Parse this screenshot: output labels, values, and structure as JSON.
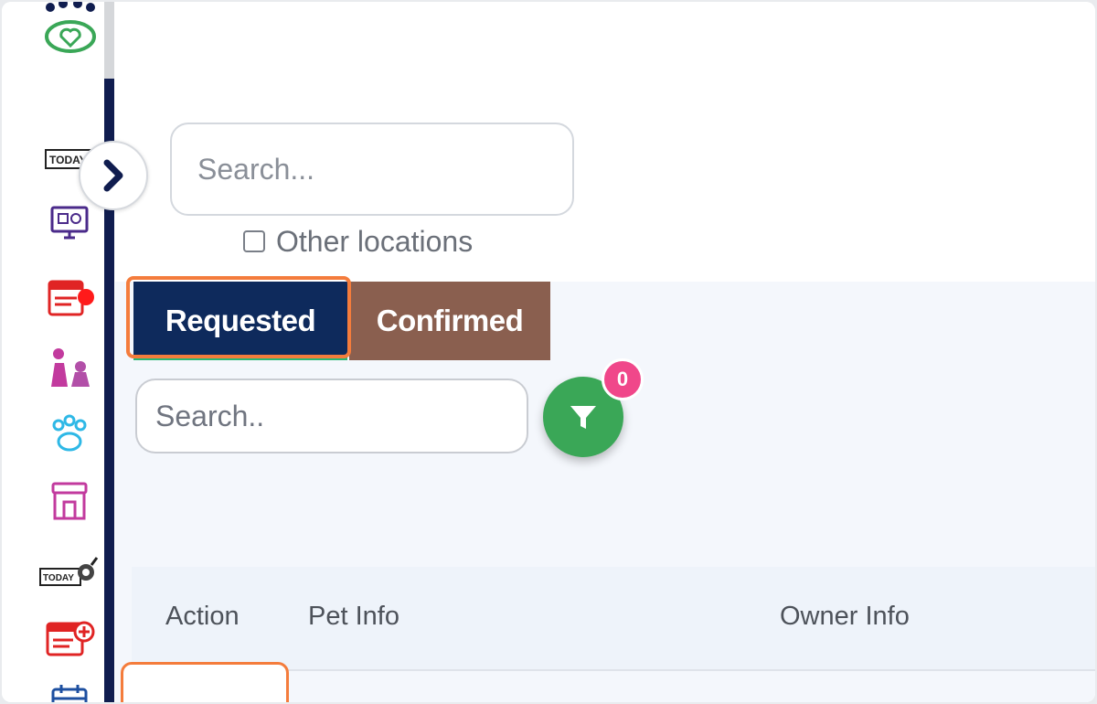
{
  "sidebar": {
    "icons": [
      "paw-heart-logo-icon",
      "today-icon",
      "monitor-icon",
      "calendar-schedule-icon",
      "pets-icon",
      "paw-icon",
      "store-icon",
      "today-whistle-icon",
      "calendar-add-icon",
      "calendar-icon"
    ],
    "expand_icon": "chevron-right-icon"
  },
  "search": {
    "placeholder": "Search..."
  },
  "other_locations": {
    "label": "Other locations",
    "checked": false
  },
  "tabs": [
    {
      "label": "Requested",
      "active": true
    },
    {
      "label": "Confirmed",
      "active": false
    }
  ],
  "list_search": {
    "placeholder": "Search.."
  },
  "filter": {
    "icon": "filter-icon",
    "badge_count": "0"
  },
  "table": {
    "columns": [
      "Action",
      "Pet Info",
      "Owner Info"
    ]
  },
  "colors": {
    "requested_tab": "#0e2a5c",
    "confirmed_tab": "#8a5f4f",
    "filter_button": "#3aa757",
    "badge": "#f0478a",
    "highlight": "#f47c3c",
    "rail_line": "#101d4f"
  }
}
